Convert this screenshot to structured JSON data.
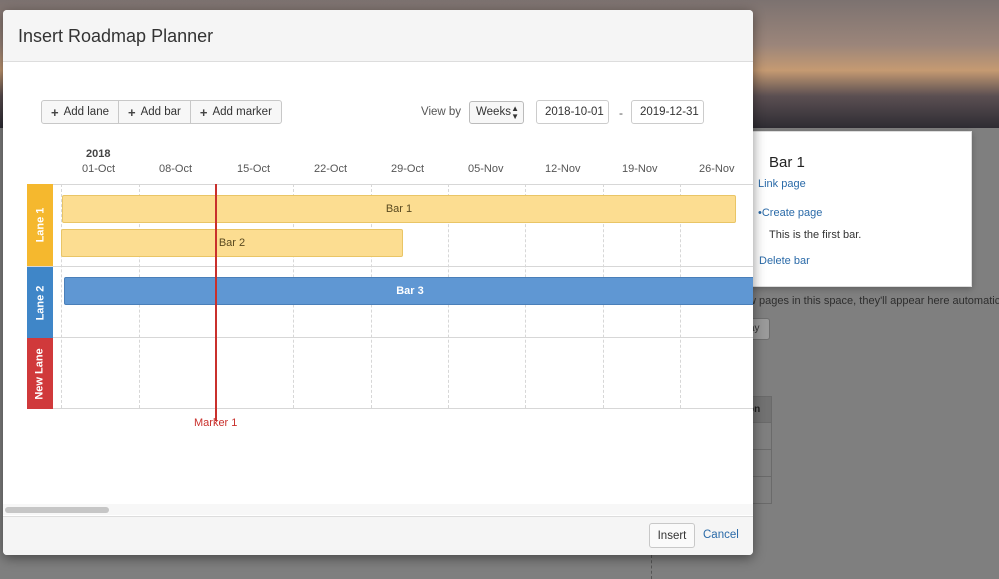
{
  "dialog": {
    "title": "Insert Roadmap Planner",
    "insert_label": "Insert",
    "cancel_label": "Cancel"
  },
  "toolbar": {
    "add_lane": "Add lane",
    "add_bar": "Add bar",
    "add_marker": "Add marker",
    "view_by_label": "View by",
    "view_by_value": "Weeks",
    "start_date": "2018-10-01",
    "range_dash": "-",
    "end_date": "2019-12-31"
  },
  "timeline": {
    "year": "2018",
    "ticks": [
      "01-Oct",
      "08-Oct",
      "15-Oct",
      "22-Oct",
      "29-Oct",
      "05-Nov",
      "12-Nov",
      "19-Nov",
      "26-Nov"
    ],
    "lanes": [
      {
        "name": "Lane 1",
        "color": "#f5b82e"
      },
      {
        "name": "Lane 2",
        "color": "#3f86c8"
      },
      {
        "name": "New Lane",
        "color": "#d0393b"
      }
    ],
    "bars": [
      {
        "title": "Bar 1",
        "lane": "Lane 1",
        "color": "#fcdd91"
      },
      {
        "title": "Bar 2",
        "lane": "Lane 1",
        "color": "#fcdd91"
      },
      {
        "title": "Bar 3",
        "lane": "Lane 2",
        "color": "#5f97d3"
      }
    ],
    "marker": {
      "title": "Marker 1",
      "color": "#c9302c"
    }
  },
  "popup": {
    "title": "Bar 1",
    "link_page": "Link page",
    "create_page": "Create page",
    "description": "This is the first bar.",
    "delete_bar": "Delete bar"
  },
  "background": {
    "notice": "w pages in this space, they'll appear here automatically",
    "button": "ay",
    "heading": "s",
    "table_header": "on"
  }
}
